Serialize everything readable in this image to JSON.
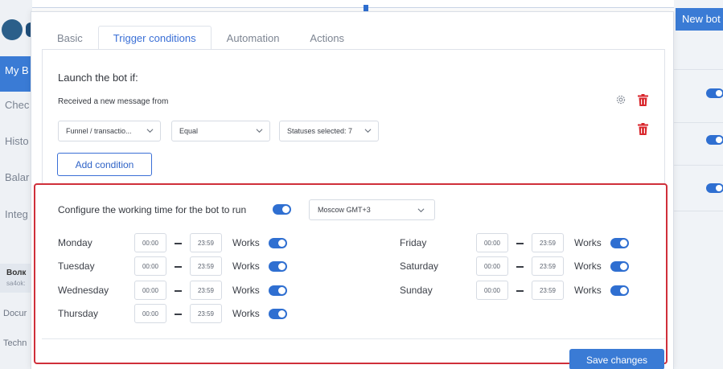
{
  "background": {
    "sidebar": {
      "active_item": "My B",
      "items": [
        "Chec",
        "Histo",
        "Balar",
        "Integ"
      ],
      "user_name": "Волк",
      "user_id": "sa4ok:",
      "bottom_items": [
        "Docur",
        "Techn"
      ]
    },
    "new_bot_label": "New bot"
  },
  "tabs": [
    "Basic",
    "Trigger conditions",
    "Automation",
    "Actions"
  ],
  "active_tab": "Trigger conditions",
  "conditions": {
    "title": "Launch the bot if:",
    "received_label": "Received a new message from",
    "filter": {
      "field": "Funnel / transactio...",
      "operator": "Equal",
      "value": "Statuses selected: 7"
    },
    "add_button": "Add condition"
  },
  "working_time": {
    "title": "Configure the working time for the bot to run",
    "enabled": true,
    "timezone": "Moscow GMT+3",
    "works_label": "Works",
    "days_left": [
      {
        "day": "Monday",
        "from": "00:00",
        "to": "23:59",
        "works": true
      },
      {
        "day": "Tuesday",
        "from": "00:00",
        "to": "23:59",
        "works": true
      },
      {
        "day": "Wednesday",
        "from": "00:00",
        "to": "23:59",
        "works": true
      },
      {
        "day": "Thursday",
        "from": "00:00",
        "to": "23:59",
        "works": true
      }
    ],
    "days_right": [
      {
        "day": "Friday",
        "from": "00:00",
        "to": "23:59",
        "works": true
      },
      {
        "day": "Saturday",
        "from": "00:00",
        "to": "23:59",
        "works": true
      },
      {
        "day": "Sunday",
        "from": "00:00",
        "to": "23:59",
        "works": true
      }
    ]
  },
  "save_button": "Save changes",
  "colors": {
    "accent": "#3a7bd5",
    "highlight_border": "#cf2f3a",
    "delete_icon": "#d9262c"
  }
}
